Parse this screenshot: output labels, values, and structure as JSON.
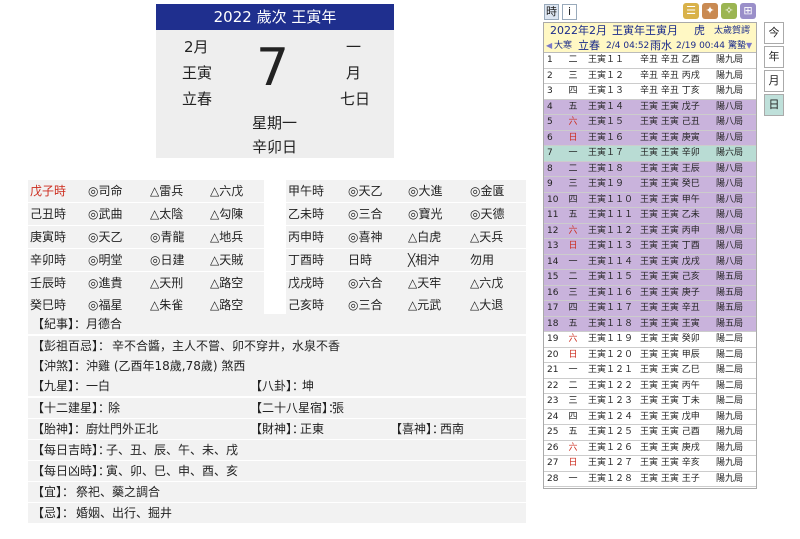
{
  "day_card": {
    "year_title": "2022 歲次 王寅年",
    "month": "2月",
    "lunar_month_label": "一",
    "ganzhi_month": "王寅",
    "month_char": "月",
    "solar_term": "立春",
    "lunar_day": "七日",
    "day_number": "7",
    "weekday": "星期一",
    "day_ganzhi": "辛卯日"
  },
  "hours": [
    {
      "hour": "戊子時",
      "a": "◎司命",
      "b": "△雷兵",
      "c": "△六戊",
      "red": true
    },
    {
      "hour": "己丑時",
      "a": "◎武曲",
      "b": "△太陰",
      "c": "△勾陳",
      "red": false
    },
    {
      "hour": "庚寅時",
      "a": "◎天乙",
      "b": "◎青龍",
      "c": "△地兵",
      "red": false
    },
    {
      "hour": "辛卯時",
      "a": "◎明堂",
      "b": "◎日建",
      "c": "△天賊",
      "red": false
    },
    {
      "hour": "壬辰時",
      "a": "◎進貴",
      "b": "△天刑",
      "c": "△路空",
      "red": false
    },
    {
      "hour": "癸巳時",
      "a": "◎福星",
      "b": "△朱雀",
      "c": "△路空",
      "red": false
    }
  ],
  "hours_right": [
    {
      "hour": "甲午時",
      "a": "◎天乙",
      "b": "◎大進",
      "c": "◎金匱"
    },
    {
      "hour": "乙未時",
      "a": "◎三合",
      "b": "◎寶光",
      "c": "◎天德"
    },
    {
      "hour": "丙申時",
      "a": "◎喜神",
      "b": "△白虎",
      "c": "△天兵"
    },
    {
      "hour": "丁酉時",
      "a": "日時",
      "b": "╳相沖",
      "c": "勿用"
    },
    {
      "hour": "戊戌時",
      "a": "◎六合",
      "b": "△天牢",
      "c": "△六戊"
    },
    {
      "hour": "己亥時",
      "a": "◎三合",
      "b": "△元武",
      "c": "△大退"
    }
  ],
  "info": {
    "jishi_label": "【紀事】：",
    "jishi": "月德合",
    "pengzu_label": "【彭祖百忌】：",
    "pengzu": "辛不合醬，主人不嘗、卯不穿井，水泉不香",
    "chongsha_label": "【沖煞】：",
    "chongsha": "沖雞 (乙酉年18歲,78歲) 煞西",
    "jiuxing_label": "【九星】：",
    "jiuxing": "一白",
    "bagua_label": "【八卦】：",
    "bagua": "坤",
    "jianxing_label": "【十二建星】：",
    "jianxing": "除",
    "xiu_label": "【二十八星宿】：",
    "xiu": "張",
    "taishen_label": "【胎神】：",
    "taishen": "廚灶門外正北",
    "caishen_label": "【財神】：",
    "caishen": "正東",
    "xishen_label": "【喜神】：",
    "xishen": "西南",
    "jishi2_label": "【每日吉時】：",
    "jishi2": "子、丑、辰、午、未、戌",
    "xiongshi_label": "【每日凶時】：",
    "xiongshi": "寅、卯、巳、申、酉、亥",
    "yi_label": "【宜】：",
    "yi": "祭祀、藥之調合",
    "ji_label": "【忌】：",
    "ji": "婚姻、出行、掘井"
  },
  "toolbar": {
    "time_btn": "時",
    "info_btn": "i"
  },
  "month_list": {
    "title": "2022年2月",
    "ganzhi": "王寅年王寅月",
    "zodiac": "虎",
    "note": "太歲賀諤",
    "term1_name": "立春",
    "term1_time": "2/4 04:52",
    "term2_name": "雨水",
    "term2_time": "2/19 00:44",
    "prev_term": "大寒",
    "next_term": "驚蟄",
    "rows": [
      {
        "d": "1",
        "w": "二",
        "lunar": "王寅１１",
        "gz": "辛丑 辛丑 乙酉",
        "ju": "陽九局",
        "bg": "",
        "wred": false
      },
      {
        "d": "2",
        "w": "三",
        "lunar": "王寅１２",
        "gz": "辛丑 辛丑 丙戌",
        "ju": "陽九局",
        "bg": "",
        "wred": false
      },
      {
        "d": "3",
        "w": "四",
        "lunar": "王寅１３",
        "gz": "辛丑 辛丑 丁亥",
        "ju": "陽九局",
        "bg": "",
        "wred": false
      },
      {
        "d": "4",
        "w": "五",
        "lunar": "王寅１４",
        "gz": "王寅 王寅 戊子",
        "ju": "陽八局",
        "bg": "purple",
        "wred": false
      },
      {
        "d": "5",
        "w": "六",
        "lunar": "王寅１５",
        "gz": "王寅 王寅 己丑",
        "ju": "陽八局",
        "bg": "purple",
        "wred": true
      },
      {
        "d": "6",
        "w": "日",
        "lunar": "王寅１６",
        "gz": "王寅 王寅 庚寅",
        "ju": "陽八局",
        "bg": "purple",
        "wred": true
      },
      {
        "d": "7",
        "w": "一",
        "lunar": "王寅１７",
        "gz": "王寅 王寅 辛卯",
        "ju": "陽六局",
        "bg": "teal",
        "wred": false
      },
      {
        "d": "8",
        "w": "二",
        "lunar": "王寅１８",
        "gz": "王寅 王寅 王辰",
        "ju": "陽八局",
        "bg": "purple",
        "wred": false
      },
      {
        "d": "9",
        "w": "三",
        "lunar": "王寅１９",
        "gz": "王寅 王寅 癸巳",
        "ju": "陽八局",
        "bg": "purple",
        "wred": false
      },
      {
        "d": "10",
        "w": "四",
        "lunar": "王寅１１０",
        "gz": "王寅 王寅 甲午",
        "ju": "陽八局",
        "bg": "purple",
        "wred": false
      },
      {
        "d": "11",
        "w": "五",
        "lunar": "王寅１１１",
        "gz": "王寅 王寅 乙未",
        "ju": "陽八局",
        "bg": "purple",
        "wred": false
      },
      {
        "d": "12",
        "w": "六",
        "lunar": "王寅１１２",
        "gz": "王寅 王寅 丙申",
        "ju": "陽八局",
        "bg": "purple",
        "wred": true
      },
      {
        "d": "13",
        "w": "日",
        "lunar": "王寅１１３",
        "gz": "王寅 王寅 丁酉",
        "ju": "陽八局",
        "bg": "purple",
        "wred": true
      },
      {
        "d": "14",
        "w": "一",
        "lunar": "王寅１１４",
        "gz": "王寅 王寅 戊戌",
        "ju": "陽八局",
        "bg": "purple",
        "wred": false
      },
      {
        "d": "15",
        "w": "二",
        "lunar": "王寅１１５",
        "gz": "王寅 王寅 己亥",
        "ju": "陽五局",
        "bg": "purple",
        "wred": false
      },
      {
        "d": "16",
        "w": "三",
        "lunar": "王寅１１６",
        "gz": "王寅 王寅 庚子",
        "ju": "陽五局",
        "bg": "purple",
        "wred": false
      },
      {
        "d": "17",
        "w": "四",
        "lunar": "王寅１１７",
        "gz": "王寅 王寅 辛丑",
        "ju": "陽五局",
        "bg": "purple",
        "wred": false
      },
      {
        "d": "18",
        "w": "五",
        "lunar": "王寅１１８",
        "gz": "王寅 王寅 王寅",
        "ju": "陽五局",
        "bg": "purple",
        "wred": false
      },
      {
        "d": "19",
        "w": "六",
        "lunar": "王寅１１９",
        "gz": "王寅 王寅 癸卯",
        "ju": "陽二局",
        "bg": "",
        "wred": true
      },
      {
        "d": "20",
        "w": "日",
        "lunar": "王寅１２０",
        "gz": "王寅 王寅 甲辰",
        "ju": "陽二局",
        "bg": "",
        "wred": true
      },
      {
        "d": "21",
        "w": "一",
        "lunar": "王寅１２１",
        "gz": "王寅 王寅 乙巳",
        "ju": "陽二局",
        "bg": "",
        "wred": false
      },
      {
        "d": "22",
        "w": "二",
        "lunar": "王寅１２２",
        "gz": "王寅 王寅 丙午",
        "ju": "陽二局",
        "bg": "",
        "wred": false
      },
      {
        "d": "23",
        "w": "三",
        "lunar": "王寅１２３",
        "gz": "王寅 王寅 丁未",
        "ju": "陽二局",
        "bg": "",
        "wred": false
      },
      {
        "d": "24",
        "w": "四",
        "lunar": "王寅１２４",
        "gz": "王寅 王寅 戊申",
        "ju": "陽九局",
        "bg": "",
        "wred": false
      },
      {
        "d": "25",
        "w": "五",
        "lunar": "王寅１２５",
        "gz": "王寅 王寅 己酉",
        "ju": "陽九局",
        "bg": "",
        "wred": false
      },
      {
        "d": "26",
        "w": "六",
        "lunar": "王寅１２６",
        "gz": "王寅 王寅 庚戌",
        "ju": "陽九局",
        "bg": "",
        "wred": true
      },
      {
        "d": "27",
        "w": "日",
        "lunar": "王寅１２７",
        "gz": "王寅 王寅 辛亥",
        "ju": "陽九局",
        "bg": "",
        "wred": true
      },
      {
        "d": "28",
        "w": "一",
        "lunar": "王寅１２８",
        "gz": "王寅 王寅 王子",
        "ju": "陽九局",
        "bg": "",
        "wred": false
      }
    ]
  },
  "side_buttons": {
    "today": "今",
    "year": "年",
    "month": "月",
    "day": "日"
  },
  "colors": {
    "title_bar": "#1f2f8e",
    "highlight_purple": "#c9b3dc",
    "highlight_teal": "#b9dcd4",
    "red_text": "#cc2b1d",
    "header_yellow": "#fff8c4"
  }
}
